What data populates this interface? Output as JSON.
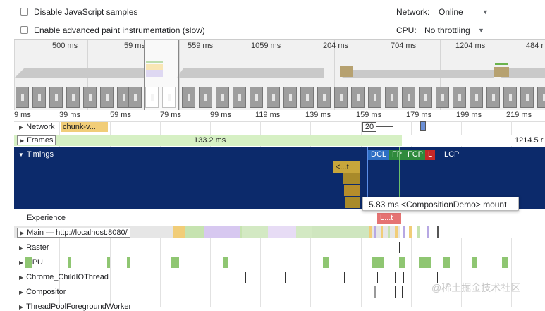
{
  "settings": {
    "disable_js_samples": "Disable JavaScript samples",
    "advanced_paint": "Enable advanced paint instrumentation (slow)",
    "network_label": "Network:",
    "network_value": "Online",
    "cpu_label": "CPU:",
    "cpu_value": "No throttling"
  },
  "overview_ticks": [
    "500 ms",
    "59 ms",
    "559 ms",
    "1059 ms",
    "204 ms",
    "704 ms",
    "1204 ms",
    "484 r"
  ],
  "ruler_ticks": [
    "9 ms",
    "39 ms",
    "59 ms",
    "79 ms",
    "99 ms",
    "119 ms",
    "139 ms",
    "159 ms",
    "179 ms",
    "199 ms",
    "219 ms"
  ],
  "tracks": {
    "network": "Network",
    "network_chunk": "chunk-v...",
    "network_badge": "20",
    "frames": "Frames",
    "frames_duration_1": "133.2 ms",
    "frames_duration_2": "1214.5 r",
    "timings": "Timings",
    "timing_event": "<...t",
    "experience": "Experience",
    "experience_event": "L...t",
    "main": "Main — http://localhost:8080/",
    "raster": "Raster",
    "gpu": "GPU",
    "child_io": "Chrome_ChildIOThread",
    "compositor": "Compositor",
    "threadpool": "ThreadPoolForegroundWorker"
  },
  "markers": {
    "dcl": "DCL",
    "fp": "FP",
    "fcp": "FCP",
    "l": "L",
    "lcp": "LCP"
  },
  "tooltip": {
    "duration": "5.83 ms",
    "label": "<CompositionDemo> mount"
  },
  "colors": {
    "timings_bg": "#0c2a6b",
    "dcl": "#2e6fc4",
    "fp": "#2f8a3c",
    "fcp": "#2f8a3c",
    "l": "#c62828",
    "frames": "#d6f0c4",
    "gpu": "#8fc672"
  },
  "watermark": "@稀土掘金技术社区"
}
